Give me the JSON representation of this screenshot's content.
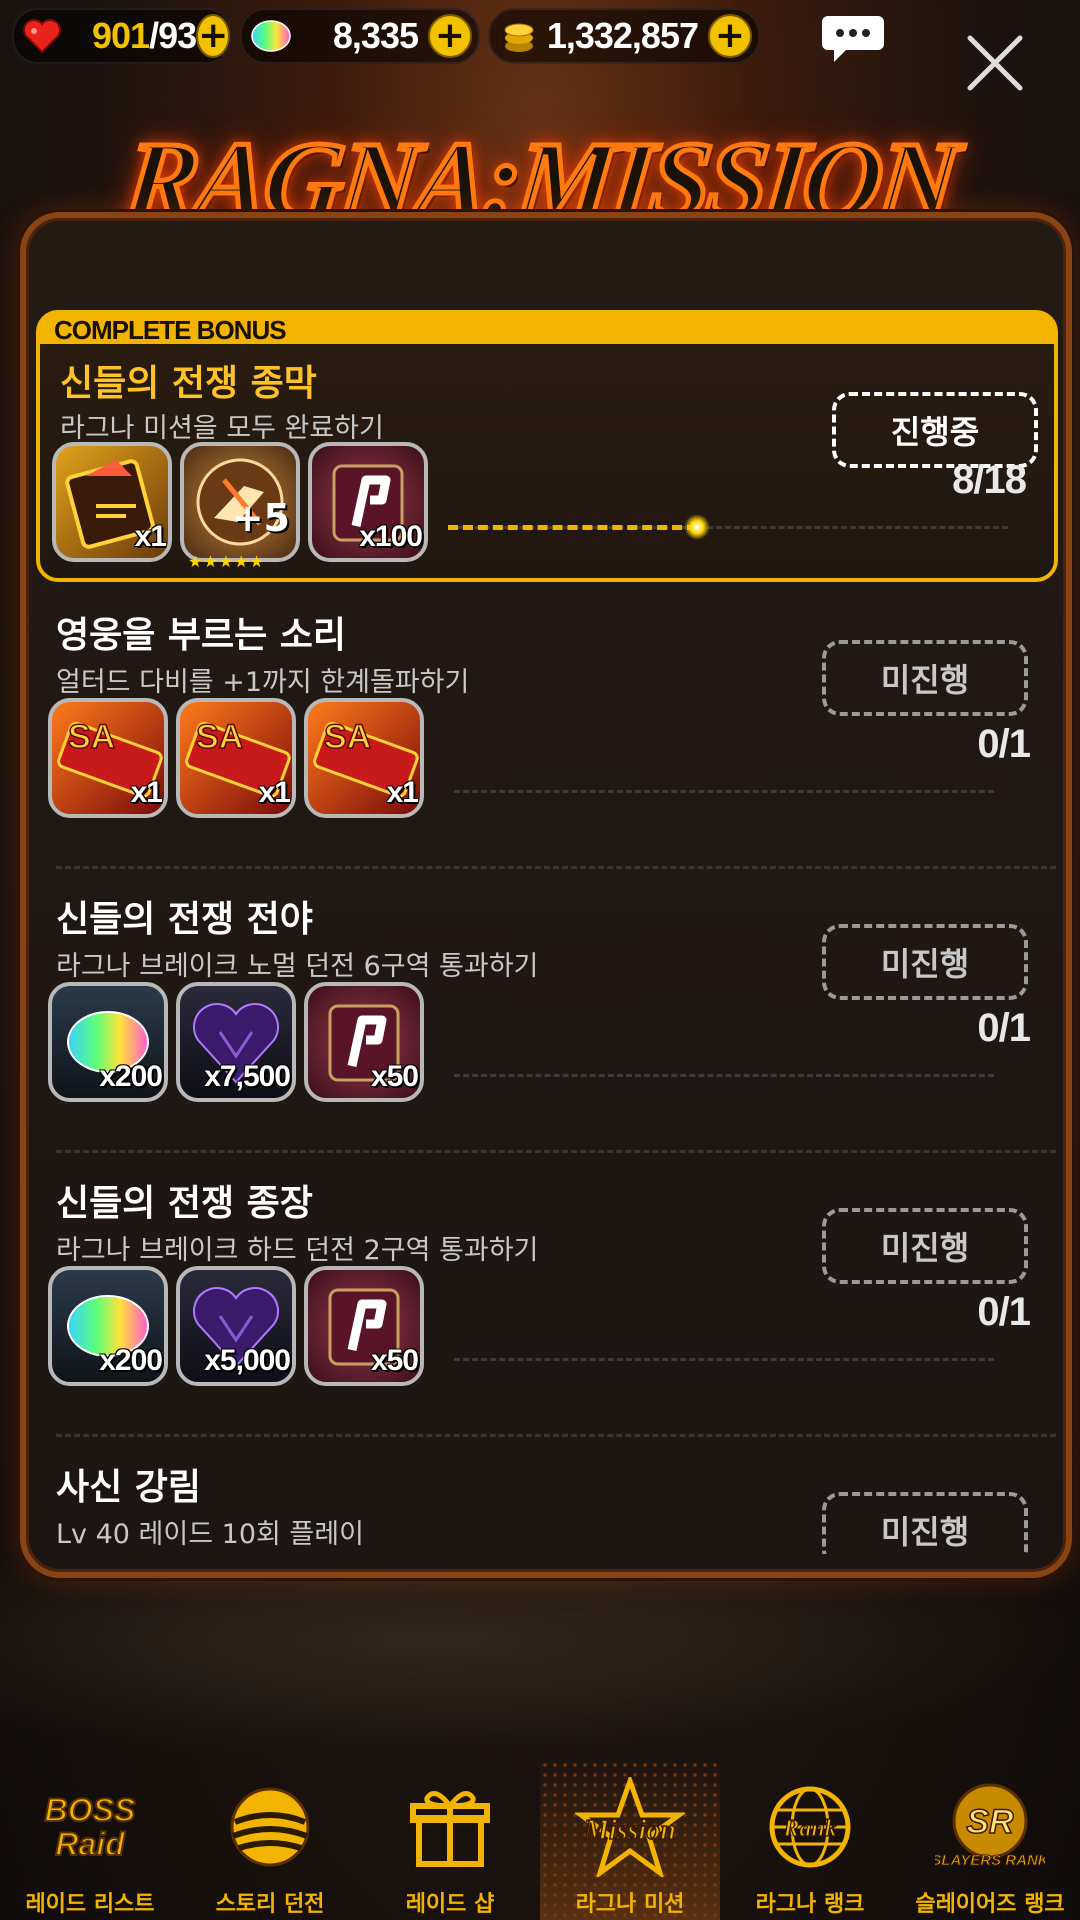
{
  "resources": [
    {
      "id": "stamina",
      "icon": "heart-icon",
      "value": "901",
      "max": "/93"
    },
    {
      "id": "gems",
      "icon": "rainbow-gem-icon",
      "value": "8,335"
    },
    {
      "id": "gold",
      "icon": "gold-coins-icon",
      "value": "1,332,857"
    }
  ],
  "title": "RAGNA:MISSION",
  "bonus": {
    "header": "COMPLETE BONUS",
    "title": "신들의 전쟁 종막",
    "desc": "라그나 미션을 모두 완료하기",
    "status": "진행중",
    "progress": "8/18",
    "progress_fraction": 0.444,
    "rewards": [
      {
        "icon": "gold-card-icon",
        "qty": "x1"
      },
      {
        "icon": "enhance-orb-icon",
        "qty": "",
        "badge": "+5",
        "stars": "★★★★★"
      },
      {
        "icon": "ragna-ticket-icon",
        "qty": "x100"
      }
    ]
  },
  "missions": [
    {
      "title": "영웅을 부르는 소리",
      "desc": "얼터드 다비를 +1까지 한계돌파하기",
      "status": "미진행",
      "progress": "0/1",
      "rewards": [
        {
          "icon": "sa-ticket-icon",
          "qty": "x1"
        },
        {
          "icon": "sa-ticket-icon",
          "qty": "x1"
        },
        {
          "icon": "sa-ticket-icon",
          "qty": "x1"
        }
      ]
    },
    {
      "title": "신들의 전쟁 전야",
      "desc": "라그나 브레이크 노멀 던전 6구역 통과하기",
      "status": "미진행",
      "progress": "0/1",
      "rewards": [
        {
          "icon": "rainbow-gem-icon",
          "qty": "x200"
        },
        {
          "icon": "dark-heart-gem-icon",
          "qty": "x7,500"
        },
        {
          "icon": "ragna-ticket-icon",
          "qty": "x50"
        }
      ]
    },
    {
      "title": "신들의 전쟁 종장",
      "desc": "라그나 브레이크 하드 던전 2구역 통과하기",
      "status": "미진행",
      "progress": "0/1",
      "rewards": [
        {
          "icon": "rainbow-gem-icon",
          "qty": "x200"
        },
        {
          "icon": "dark-heart-gem-icon",
          "qty": "x5,000"
        },
        {
          "icon": "ragna-ticket-icon",
          "qty": "x50"
        }
      ]
    },
    {
      "title": "사신 강림",
      "desc": "Lv 40 레이드 10회 플레이",
      "status": "미진행"
    }
  ],
  "nav": [
    {
      "label": "레이드 리스트",
      "icon": "boss-raid-icon",
      "logo": "BOSS Raid"
    },
    {
      "label": "스토리 던전",
      "icon": "story-dungeon-icon"
    },
    {
      "label": "레이드 샵",
      "icon": "gift-box-icon"
    },
    {
      "label": "라그나 미션",
      "icon": "mission-star-icon",
      "logo": "Mission",
      "active": true
    },
    {
      "label": "라그나 랭크",
      "icon": "rank-globe-icon",
      "logo": "Rank"
    },
    {
      "label": "슬레이어즈 랭크",
      "icon": "slayers-rank-icon",
      "logo": "SLAYERS RANK"
    }
  ],
  "colors": {
    "accent": "#f2b400",
    "panel_border": "#8a4414",
    "title_glow": "#ff7a10"
  }
}
